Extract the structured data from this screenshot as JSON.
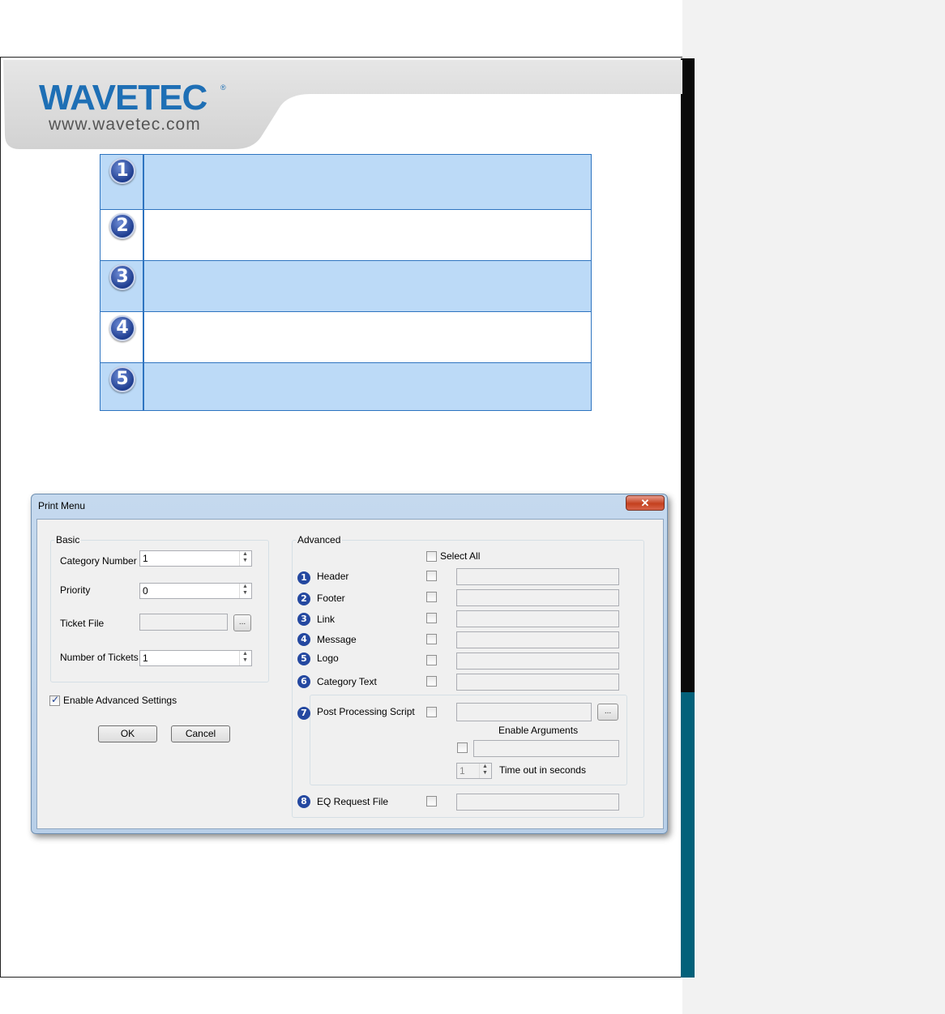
{
  "logo": {
    "word": "WAVETEC",
    "registered": "®",
    "url": "www.wavetec.com"
  },
  "steps": [
    "1",
    "2",
    "3",
    "4",
    "5"
  ],
  "dialog": {
    "title": "Print Menu",
    "close_label": "✕",
    "basic": {
      "legend": "Basic",
      "category_number_label": "Category Number",
      "category_number_value": "1",
      "priority_label": "Priority",
      "priority_value": "0",
      "ticket_file_label": "Ticket File",
      "browse_label": "...",
      "number_of_tickets_label": "Number of Tickets",
      "number_of_tickets_value": "1"
    },
    "enable_advanced_label": "Enable Advanced Settings",
    "ok_label": "OK",
    "cancel_label": "Cancel",
    "advanced": {
      "legend": "Advanced",
      "select_all_label": "Select All",
      "items": [
        {
          "num": "1",
          "label": "Header"
        },
        {
          "num": "2",
          "label": "Footer"
        },
        {
          "num": "3",
          "label": "Link"
        },
        {
          "num": "4",
          "label": "Message"
        },
        {
          "num": "5",
          "label": "Logo"
        },
        {
          "num": "6",
          "label": "Category Text"
        },
        {
          "num": "7",
          "label": "Post Processing Script"
        },
        {
          "num": "8",
          "label": "EQ Request File"
        }
      ],
      "script_browse_label": "...",
      "enable_arguments_label": "Enable Arguments",
      "timeout_value": "1",
      "timeout_label": "Time out in seconds"
    }
  }
}
